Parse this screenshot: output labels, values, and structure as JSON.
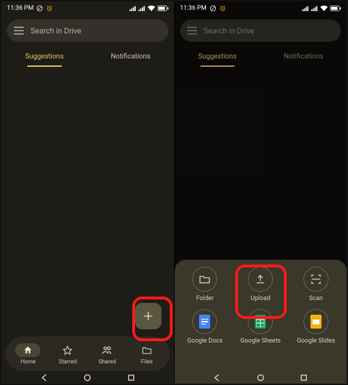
{
  "status": {
    "time": "11:36 PM",
    "alarm_icon": "alarm",
    "dnd_icon": "do-not-disturb"
  },
  "search": {
    "placeholder": "Search in Drive"
  },
  "tabs": {
    "suggestions": "Suggestions",
    "notifications": "Notifications"
  },
  "nav": {
    "home": "Home",
    "starred": "Starred",
    "shared": "Shared",
    "files": "Files"
  },
  "sheet": {
    "folder": "Folder",
    "upload": "Upload",
    "scan": "Scan",
    "docs": "Google Docs",
    "sheets": "Google Sheets",
    "slides": "Google Slides"
  },
  "colors": {
    "accent": "#e2c26b",
    "docs": "#4285f4",
    "sheets": "#0f9d58",
    "slides": "#f4b400",
    "highlight": "#ff1a1a"
  }
}
